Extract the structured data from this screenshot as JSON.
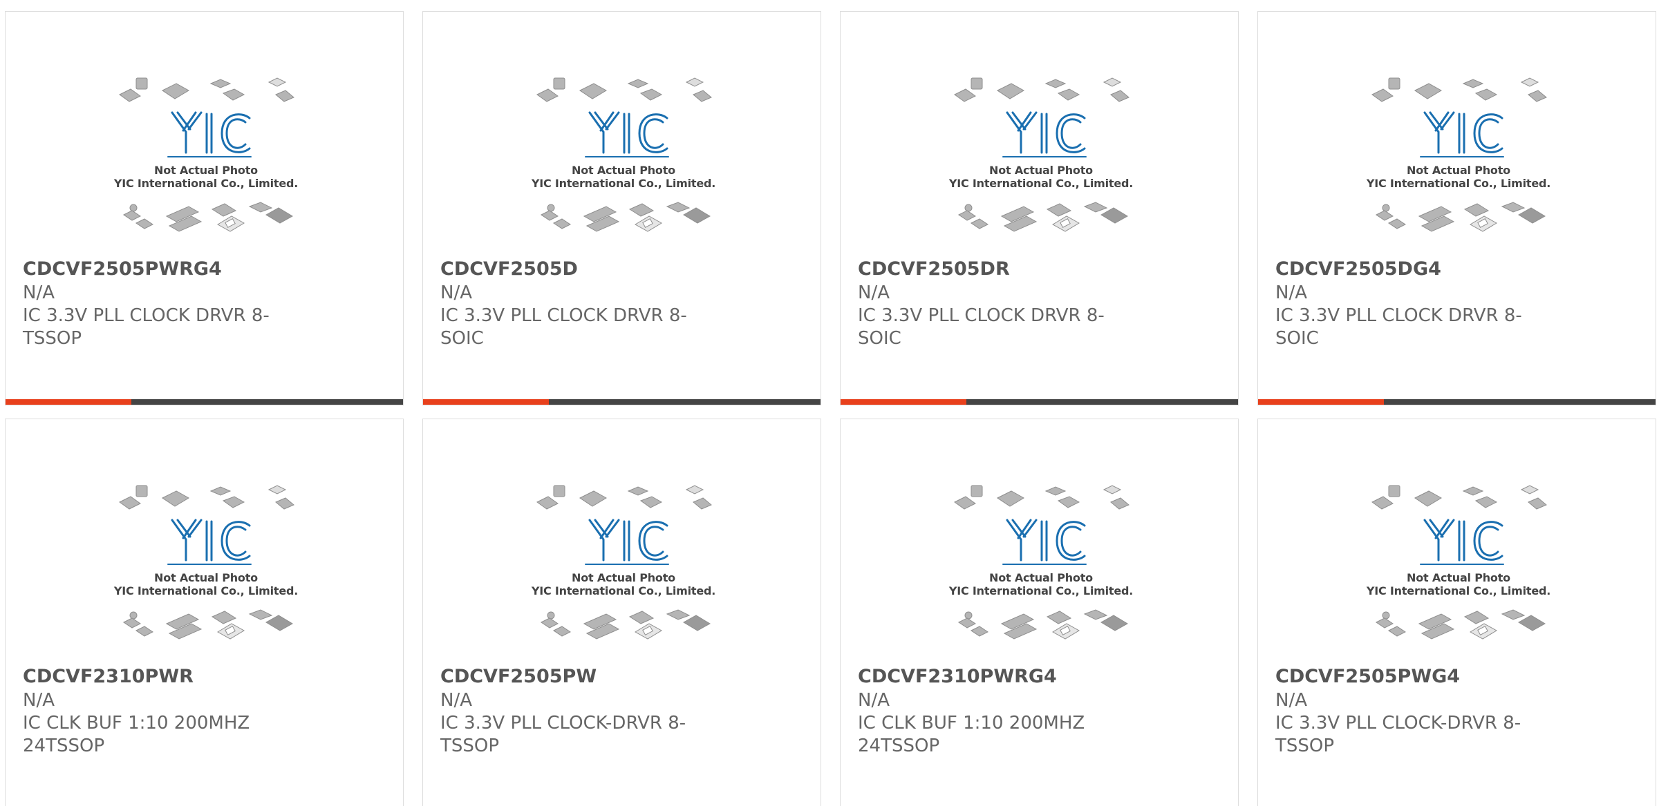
{
  "products": [
    {
      "part": "CDCVF2505PWRG4",
      "mfr": "N/A",
      "desc": "IC 3.3V PLL CLOCK DRVR 8-TSSOP",
      "image_caption_1": "Not Actual Photo",
      "image_caption_2": "YIC International Co., Limited."
    },
    {
      "part": "CDCVF2505D",
      "mfr": "N/A",
      "desc": "IC 3.3V PLL CLOCK DRVR 8-SOIC",
      "image_caption_1": "Not Actual Photo",
      "image_caption_2": "YIC International Co., Limited."
    },
    {
      "part": "CDCVF2505DR",
      "mfr": "N/A",
      "desc": "IC 3.3V PLL CLOCK DRVR 8-SOIC",
      "image_caption_1": "Not Actual Photo",
      "image_caption_2": "YIC International Co., Limited."
    },
    {
      "part": "CDCVF2505DG4",
      "mfr": "N/A",
      "desc": "IC 3.3V PLL CLOCK DRVR 8-SOIC",
      "image_caption_1": "Not Actual Photo",
      "image_caption_2": "YIC International Co., Limited."
    },
    {
      "part": "CDCVF2310PWR",
      "mfr": "N/A",
      "desc": "IC CLK BUF 1:10 200MHZ 24TSSOP",
      "image_caption_1": "Not Actual Photo",
      "image_caption_2": "YIC International Co., Limited."
    },
    {
      "part": "CDCVF2505PW",
      "mfr": "N/A",
      "desc": "IC 3.3V PLL CLOCK-DRVR 8-TSSOP",
      "image_caption_1": "Not Actual Photo",
      "image_caption_2": "YIC International Co., Limited."
    },
    {
      "part": "CDCVF2310PWRG4",
      "mfr": "N/A",
      "desc": "IC CLK BUF 1:10 200MHZ 24TSSOP",
      "image_caption_1": "Not Actual Photo",
      "image_caption_2": "YIC International Co., Limited."
    },
    {
      "part": "CDCVF2505PWG4",
      "mfr": "N/A",
      "desc": "IC 3.3V PLL CLOCK-DRVR 8-TSSOP",
      "image_caption_1": "Not Actual Photo",
      "image_caption_2": "YIC International Co., Limited."
    }
  ],
  "icons": {
    "placeholder_image": "yic-placeholder-icon"
  },
  "colors": {
    "accent": "#e8401c",
    "bar": "#444444",
    "logo": "#1a6fb0"
  }
}
